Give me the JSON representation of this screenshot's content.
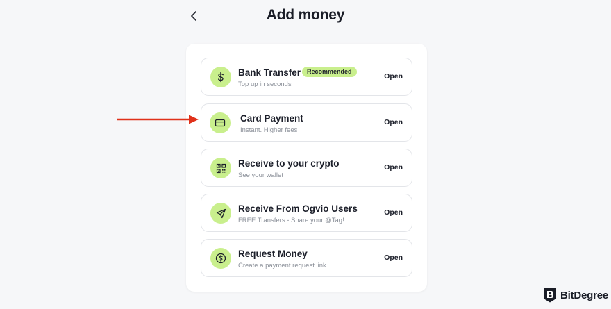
{
  "header": {
    "title": "Add money",
    "back_icon": "chevron-left-icon"
  },
  "options": [
    {
      "title": "Bank Transfer",
      "subtitle": "Top up in seconds",
      "action": "Open",
      "badge": "Recommended",
      "icon": "dollar-icon"
    },
    {
      "title": "Card Payment",
      "subtitle": "Instant. Higher fees",
      "action": "Open",
      "icon": "credit-card-icon"
    },
    {
      "title": "Receive to your crypto",
      "subtitle": "See your wallet",
      "action": "Open",
      "icon": "qr-code-icon"
    },
    {
      "title": "Receive From Ogvio Users",
      "subtitle": "FREE Transfers - Share your @Tag!",
      "action": "Open",
      "icon": "send-icon"
    },
    {
      "title": "Request Money",
      "subtitle": "Create a payment request link",
      "action": "Open",
      "icon": "dollar-circle-icon"
    }
  ],
  "annotation": {
    "icon": "red-arrow-icon",
    "color": "#e0311a"
  },
  "watermark": {
    "text": "BitDegree",
    "icon": "bitdegree-logo-icon"
  },
  "colors": {
    "accent": "#c9ef8d",
    "background": "#f6f7f9",
    "card": "#ffffff",
    "text": "#1c1f2a",
    "muted": "#8a8f98"
  }
}
